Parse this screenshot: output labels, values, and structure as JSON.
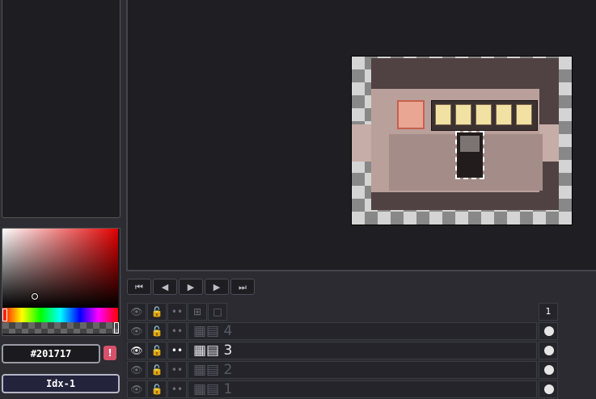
{
  "color": {
    "hex_value": "#201717",
    "warning_glyph": "!",
    "index_value": "Idx-1",
    "accent": "#e30000"
  },
  "playback": {
    "first": "⏮",
    "prev": "◀",
    "play": "▶",
    "next": "▶",
    "last": "⏭"
  },
  "timeline": {
    "frame_header": "1",
    "header_icons": [
      "eye-icon",
      "lock-icon",
      "link-icon",
      "tree-icon",
      "frame-icon"
    ],
    "layers": [
      {
        "name": "4",
        "active": false
      },
      {
        "name": "3",
        "active": true
      },
      {
        "name": "2",
        "active": false
      },
      {
        "name": "1",
        "active": false
      }
    ]
  }
}
